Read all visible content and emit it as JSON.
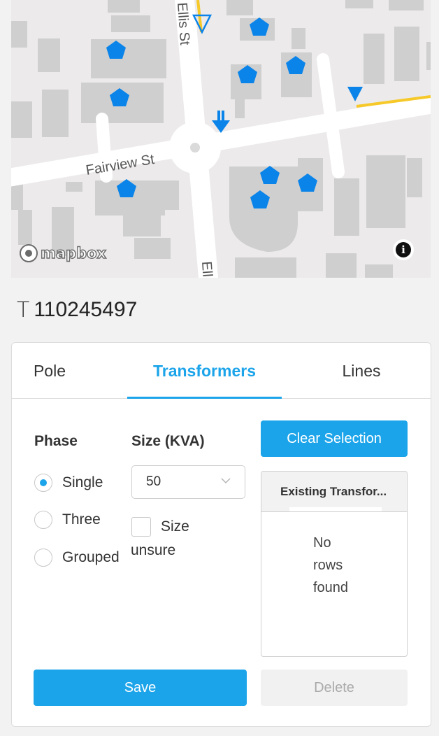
{
  "map": {
    "street_labels": [
      "Fairview St",
      "Ellis St",
      "Ell"
    ],
    "attribution_logo": "mapbox",
    "info_icon": "i",
    "colors": {
      "marker": "#0b84e9",
      "highlight_line": "#f6c928"
    }
  },
  "pole": {
    "icon": "T",
    "id": "110245497"
  },
  "tabs": [
    {
      "label": "Pole"
    },
    {
      "label": "Transformers"
    },
    {
      "label": "Lines"
    }
  ],
  "active_tab": "Transformers",
  "transformers": {
    "phase_label": "Phase",
    "phase_options": [
      "Single",
      "Three",
      "Grouped"
    ],
    "phase_selected": "Single",
    "size_label": "Size (KVA)",
    "size_value": "50",
    "size_unsure_line1": "Size",
    "size_unsure_line2": "unsure",
    "clear_button": "Clear Selection",
    "existing_header": "Existing Transfor...",
    "empty_line1": "No",
    "empty_line2": "rows",
    "empty_line3": "found",
    "save_button": "Save",
    "delete_button": "Delete"
  },
  "colors": {
    "accent": "#1ba4ea"
  }
}
